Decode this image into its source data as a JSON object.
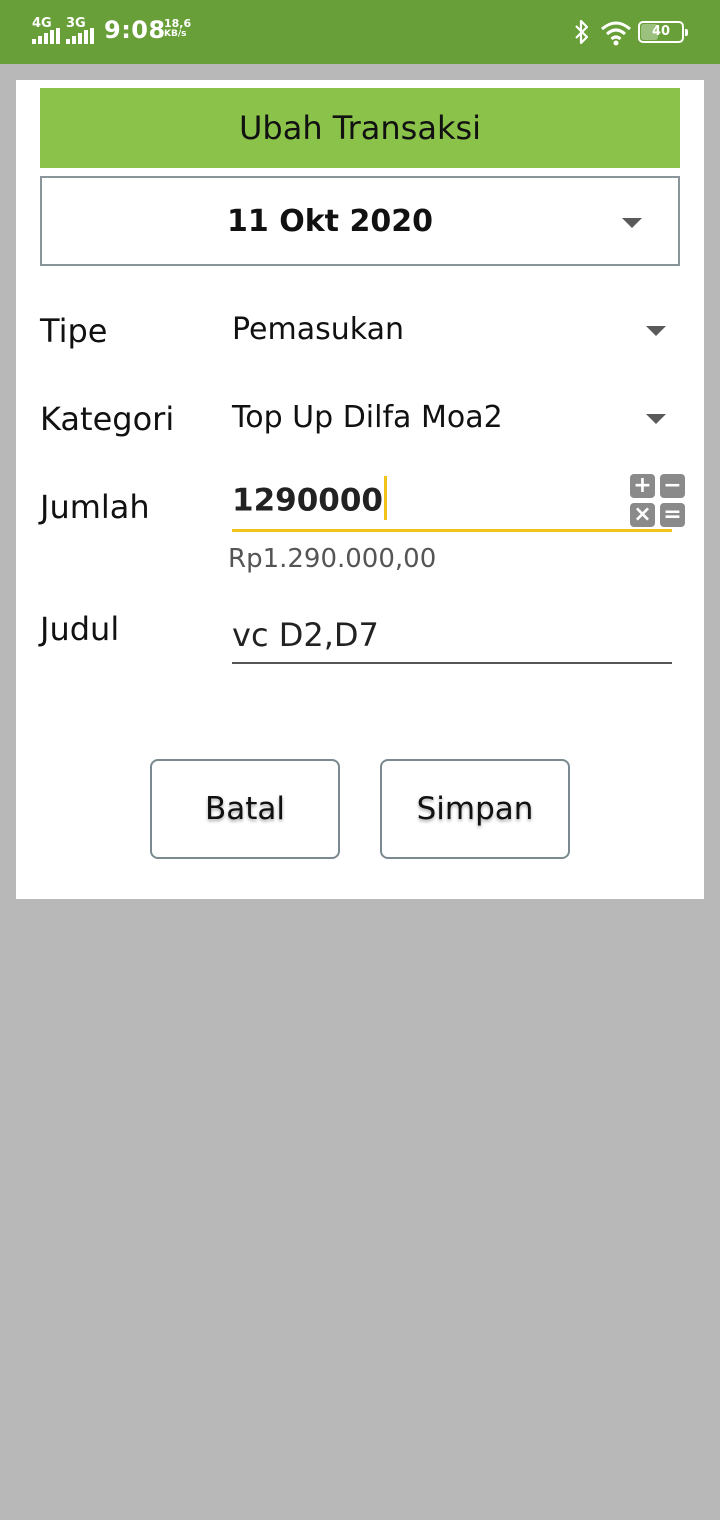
{
  "status_bar": {
    "network1": "4G",
    "network2": "3G",
    "time": "9:08",
    "speed_value": "18,6",
    "speed_unit": "KB/s",
    "battery": "40",
    "icons": [
      "signal-icon",
      "bluetooth-icon",
      "wifi-icon",
      "battery-icon"
    ]
  },
  "dialog": {
    "title": "Ubah Transaksi",
    "date": "11 Okt 2020",
    "type_label": "Tipe",
    "type_value": "Pemasukan",
    "category_label": "Kategori",
    "category_value": "Top Up Dilfa Moa2",
    "amount_label": "Jumlah",
    "amount_value": "1290000",
    "amount_formatted": "Rp1.290.000,00",
    "calc_keys": [
      "+",
      "−",
      "×",
      "="
    ],
    "title_label": "Judul",
    "title_value": "vc D2,D7",
    "cancel_label": "Batal",
    "save_label": "Simpan"
  },
  "colors": {
    "status_bar": "#689f38",
    "title_bar": "#8bc34a",
    "focus_underline": "#f0c419",
    "backdrop": "#b8b8b8"
  }
}
